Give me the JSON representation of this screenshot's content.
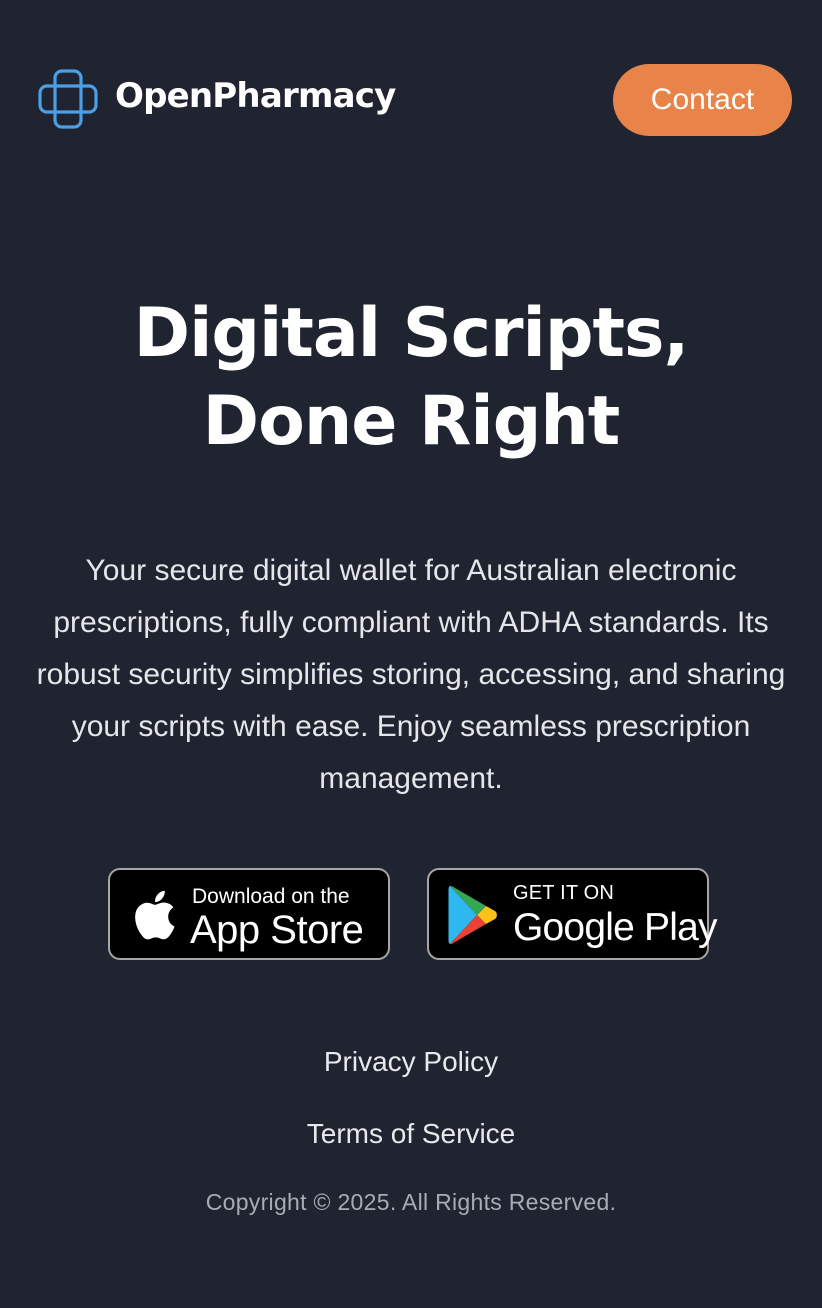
{
  "header": {
    "brand": "OpenPharmacy",
    "contact_label": "Contact"
  },
  "hero": {
    "title_line1": "Digital Scripts,",
    "title_line2": "Done Right",
    "description": "Your secure digital wallet for Australian electronic prescriptions, fully compliant with ADHA standards. Its robust security simplifies storing, accessing, and sharing your scripts with ease. Enjoy seamless prescription management."
  },
  "stores": {
    "apple": {
      "small": "Download on the",
      "large": "App Store",
      "icon": "apple-icon"
    },
    "google": {
      "small": "GET IT ON",
      "large": "Google Play",
      "icon": "google-play-icon"
    }
  },
  "footer": {
    "privacy": "Privacy Policy",
    "terms": "Terms of Service",
    "copyright": "Copyright © 2025. All Rights Reserved."
  },
  "colors": {
    "background": "#1f2430",
    "accent": "#e8834a",
    "logo_blue": "#4a9fe8"
  }
}
